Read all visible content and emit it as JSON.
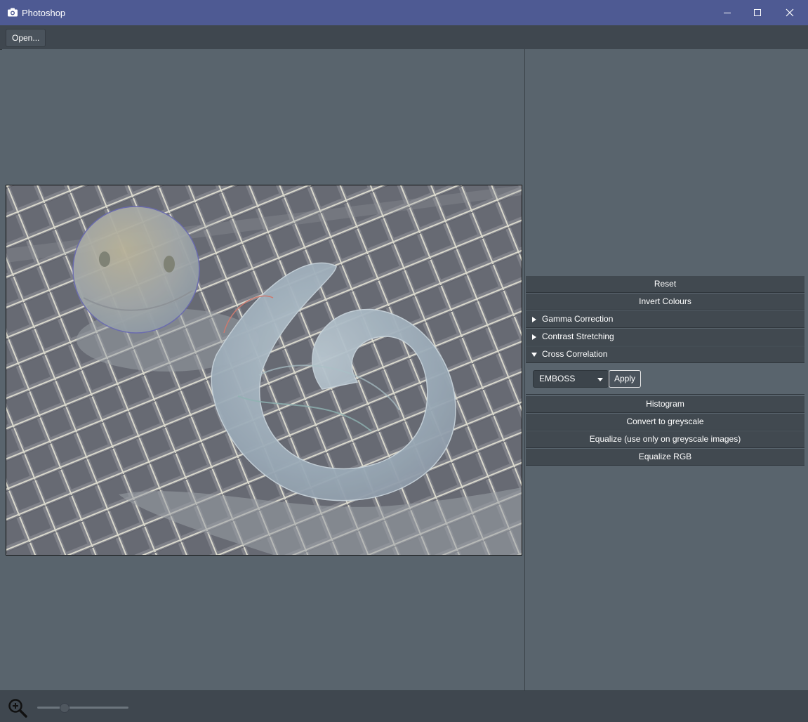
{
  "window": {
    "title": "Photoshop",
    "icons": {
      "app": "camera-icon",
      "minimize": "minimize-icon",
      "maximize": "maximize-icon",
      "close": "close-icon"
    }
  },
  "toolbar": {
    "open_label": "Open..."
  },
  "panel": {
    "reset_label": "Reset",
    "invert_label": "Invert Colours",
    "gamma_label": "Gamma Correction",
    "contrast_label": "Contrast Stretching",
    "cross_label": "Cross Correlation",
    "kernel_selected": "EMBOSS",
    "apply_label": "Apply",
    "histogram_label": "Histogram",
    "greyscale_label": "Convert to greyscale",
    "equalize_label": "Equalize (use only on greyscale images)",
    "equalize_rgb_label": "Equalize RGB"
  },
  "status": {
    "zoom_icon": "zoom-in-icon",
    "zoom_fraction": 0.3
  },
  "colors": {
    "titlebar": "#4e5a93",
    "background": "#59646d",
    "panel_button": "#414950"
  }
}
